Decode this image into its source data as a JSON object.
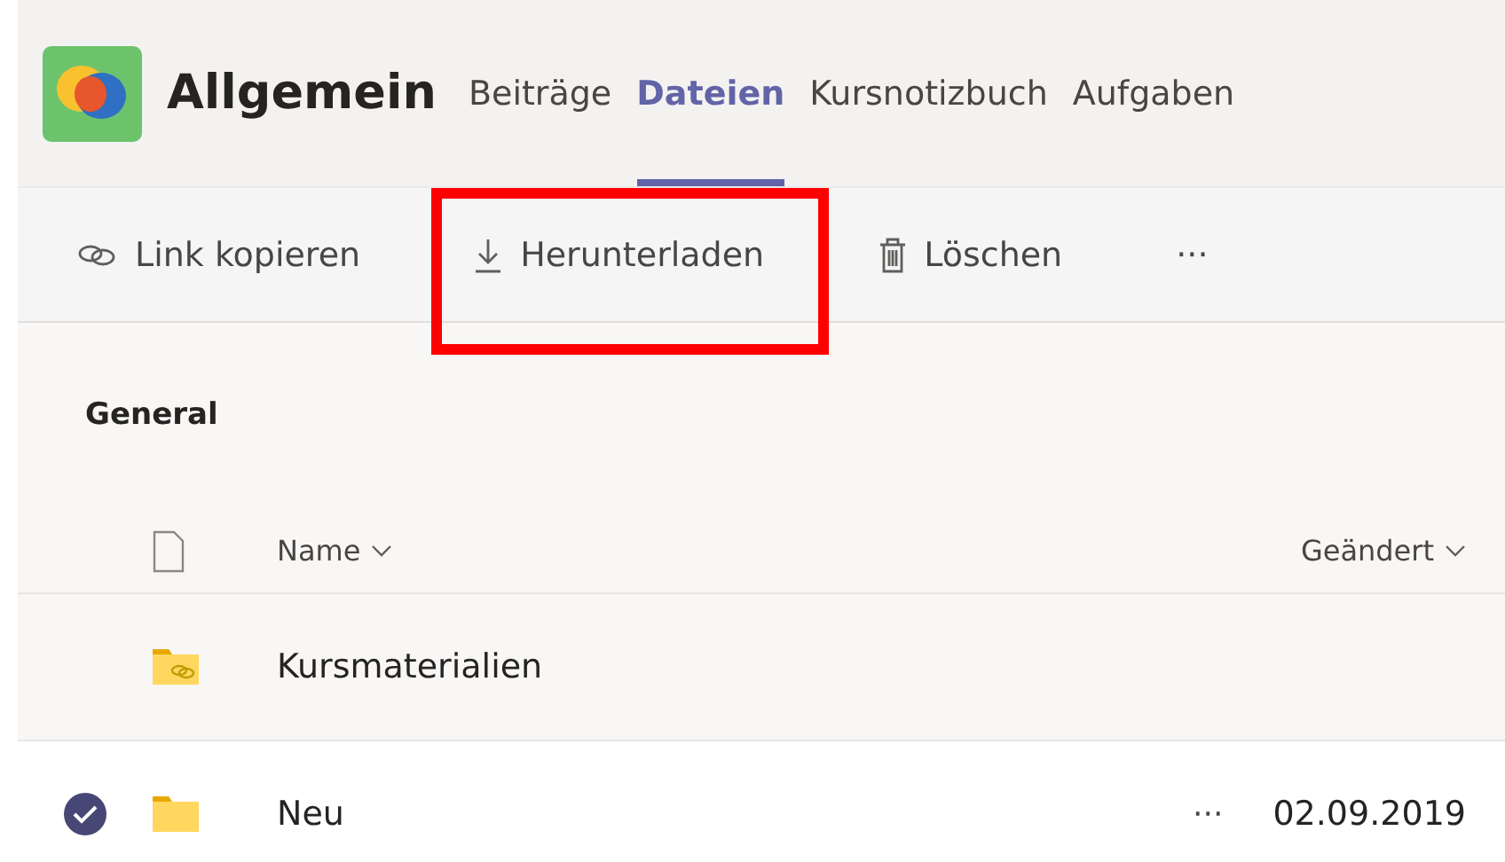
{
  "channel": {
    "title": "Allgemein"
  },
  "tabs": [
    {
      "label": "Beiträge",
      "selected": false
    },
    {
      "label": "Dateien",
      "selected": true
    },
    {
      "label": "Kursnotizbuch",
      "selected": false
    },
    {
      "label": "Aufgaben",
      "selected": false
    }
  ],
  "toolbar": [
    {
      "kind": "link",
      "label": "Link kopieren",
      "highlighted": false
    },
    {
      "kind": "download",
      "label": "Herunterladen",
      "highlighted": true
    },
    {
      "kind": "delete",
      "label": "Löschen",
      "highlighted": false
    },
    {
      "kind": "more",
      "label": "···",
      "highlighted": false
    }
  ],
  "section": "General",
  "columns": {
    "name": "Name",
    "modified": "Geändert"
  },
  "rows": [
    {
      "kind": "shared",
      "name": "Kursmaterialien",
      "selected": false
    },
    {
      "kind": "folder",
      "name": "Neu",
      "selected": true,
      "more": "···",
      "modified": "02.09.2019"
    }
  ]
}
